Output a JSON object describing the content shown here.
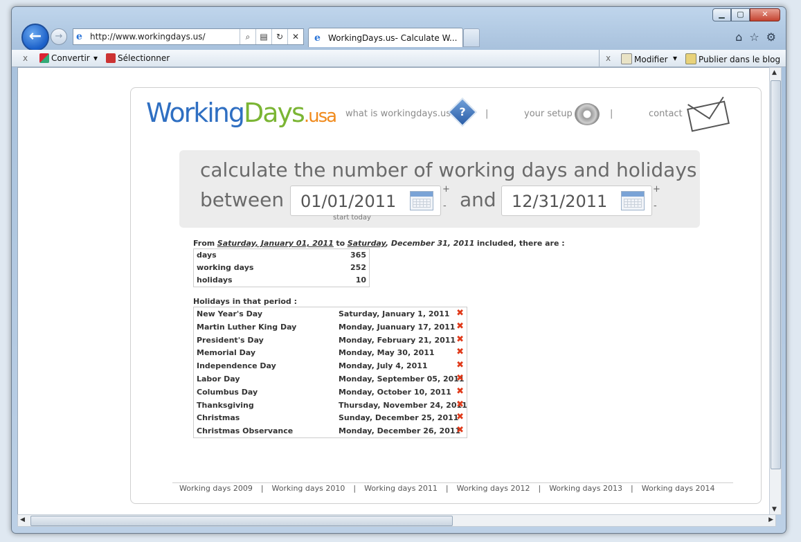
{
  "browser": {
    "url": "http://www.workingdays.us/",
    "tab_title": "WorkingDays.us- Calculate W...",
    "cmd_left": {
      "convert": "Convertir",
      "select": "Sélectionner"
    },
    "cmd_right": {
      "modify": "Modifier",
      "publish": "Publier dans le blog"
    }
  },
  "site": {
    "logo": {
      "part1": "Working",
      "part2": "Days",
      "part3": ".usa"
    },
    "nav": {
      "what": "what is workingdays.us",
      "setup": "your setup",
      "contact": "contact",
      "sep": "|"
    },
    "calc": {
      "line1": "calculate the number of working days and holidays",
      "between": "between",
      "and": "and",
      "start_date": "01/01/2011",
      "end_date": "12/31/2011",
      "plus": "+",
      "minus": "-",
      "start_today": "start today"
    },
    "summary": {
      "from": "From",
      "start_day": "Saturday, January 01, 2011",
      "to": "to",
      "end_day": "Saturday",
      "end_rest": ", December 31, 2011",
      "tail": "included, there are :",
      "rows": [
        {
          "label": "days",
          "value": "365"
        },
        {
          "label": "working days",
          "value": "252"
        },
        {
          "label": "holidays",
          "value": "10"
        }
      ]
    },
    "holidays": {
      "heading": "Holidays in that period :",
      "rows": [
        {
          "name": "New Year's Day",
          "date": "Saturday, January 1, 2011"
        },
        {
          "name": "Martin Luther King Day",
          "date": "Monday, Juanuary 17, 2011"
        },
        {
          "name": "President's Day",
          "date": "Monday, February 21, 2011"
        },
        {
          "name": "Memorial Day",
          "date": "Monday, May 30, 2011"
        },
        {
          "name": "Independence Day",
          "date": "Monday, July 4, 2011"
        },
        {
          "name": "Labor Day",
          "date": "Monday, September 05, 2011"
        },
        {
          "name": "Columbus Day",
          "date": "Monday, October 10, 2011"
        },
        {
          "name": "Thanksgiving",
          "date": "Thursday, November 24, 2011"
        },
        {
          "name": "Christmas",
          "date": "Sunday, December 25, 2011"
        },
        {
          "name": "Christmas Observance",
          "date": "Monday, December 26, 2011"
        }
      ],
      "remove_glyph": "✖"
    },
    "footer": {
      "links": [
        "Working days 2009",
        "Working days 2010",
        "Working days 2011",
        "Working days 2012",
        "Working days 2013",
        "Working days 2014"
      ],
      "sep": "|"
    }
  }
}
